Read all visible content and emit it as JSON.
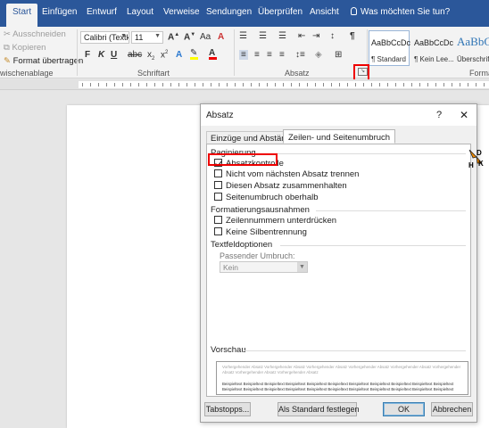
{
  "tabs": [
    "Start",
    "Einfügen",
    "Entwurf",
    "Layout",
    "Verweise",
    "Sendungen",
    "Überprüfen",
    "Ansicht"
  ],
  "tell_me": "Was möchten Sie tun?",
  "clipboard": {
    "cut": "Ausschneiden",
    "copy": "Kopieren",
    "format_painter": "Format übertragen",
    "group": "wischenablage"
  },
  "font": {
    "name": "Calibri (Textk",
    "size": "11",
    "group": "Schriftart"
  },
  "paragraph": {
    "group": "Absatz"
  },
  "styles": {
    "items": [
      {
        "sample": "AaBbCcDc",
        "name": "¶ Standard"
      },
      {
        "sample": "AaBbCcDc",
        "name": "¶ Kein Lee..."
      },
      {
        "sample": "AaBbC",
        "name": "Überschrif..."
      }
    ],
    "group": "Forma"
  },
  "dialog": {
    "title": "Absatz",
    "help": "?",
    "close": "✕",
    "tabs": [
      "Einzüge und Abstände",
      "Zeilen- und Seitenumbruch"
    ],
    "pagination": {
      "label": "Paginierung",
      "options": [
        {
          "label": "Absatzkontrolle",
          "checked": true
        },
        {
          "label": "Nicht vom nächsten Absatz trennen",
          "checked": false
        },
        {
          "label": "Diesen Absatz zusammenhalten",
          "checked": false
        },
        {
          "label": "Seitenumbruch oberhalb",
          "checked": false
        }
      ]
    },
    "formatting_exceptions": {
      "label": "Formatierungsausnahmen",
      "options": [
        {
          "label": "Zeilennummern unterdrücken",
          "checked": false
        },
        {
          "label": "Keine Silbentrennung",
          "checked": false
        }
      ]
    },
    "textbox": {
      "label": "Textfeldoptionen",
      "wrap_label": "Passender Umbruch:",
      "wrap_value": "Kein"
    },
    "preview": {
      "label": "Vorschau",
      "before": "Vorhergehender Absatz Vorhergehender Absatz Vorhergehender Absatz Vorhergehender Absatz Vorhergehender Absatz Vorhergehender Absatz Vorhergehender Absatz Vorhergehender Absatz",
      "sample": "Beispieltext Beispieltext Beispieltext Beispieltext Beispieltext Beispieltext Beispieltext Beispieltext Beispieltext Beispieltext Beispieltext Beispieltext Beispieltext Beispieltext Beispieltext Beispieltext Beispieltext Beispieltext Beispieltext Beispieltext Beispieltext Beispieltext"
    },
    "buttons": {
      "tabs": "Tabstopps...",
      "default": "Als Standard festlegen",
      "ok": "OK",
      "cancel": "Abbrechen"
    }
  },
  "colors": {
    "ribbon_blue": "#2b579a",
    "highlight_red": "#e00000"
  }
}
